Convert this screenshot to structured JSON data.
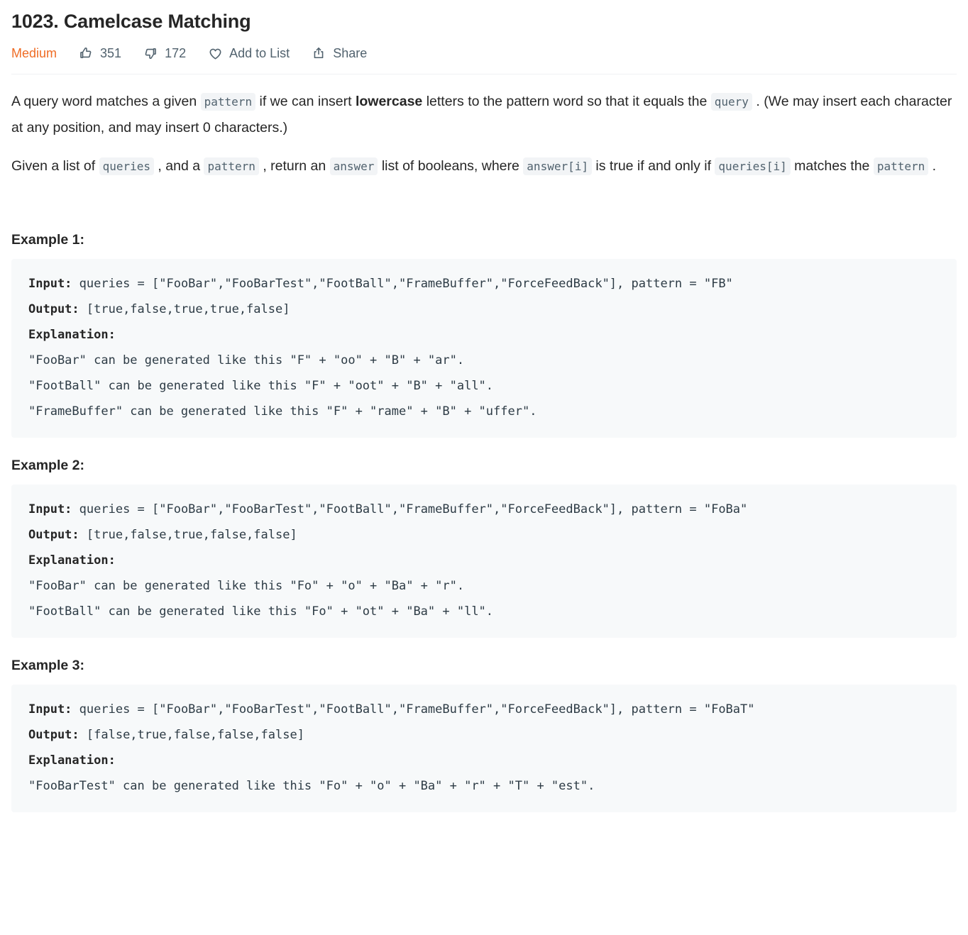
{
  "problem": {
    "title": "1023. Camelcase Matching",
    "difficulty": "Medium",
    "likes": "351",
    "dislikes": "172",
    "add_to_list_label": "Add to List",
    "share_label": "Share"
  },
  "icons": {
    "like": "thumbs-up-icon",
    "dislike": "thumbs-down-icon",
    "favorite": "heart-icon",
    "share": "share-icon"
  },
  "description": {
    "p1": {
      "t1": "A query word matches a given ",
      "c1": "pattern",
      "t2": " if we can insert ",
      "b1": "lowercase",
      "t3": " letters to the pattern word so that it equals the ",
      "c2": "query",
      "t4": " . (We may insert each character at any position, and may insert 0 characters.)"
    },
    "p2": {
      "t1": "Given a list of ",
      "c1": "queries",
      "t2": " , and a ",
      "c2": "pattern",
      "t3": " , return an ",
      "c3": "answer",
      "t4": " list of booleans, where ",
      "c4": "answer[i]",
      "t5": " is true if and only if ",
      "c5": "queries[i]",
      "t6": " matches the ",
      "c6": "pattern",
      "t7": " ."
    }
  },
  "examples": [
    {
      "heading": "Example 1:",
      "input_label": "Input:",
      "input_value": " queries = [\"FooBar\",\"FooBarTest\",\"FootBall\",\"FrameBuffer\",\"ForceFeedBack\"], pattern = \"FB\"",
      "output_label": "Output:",
      "output_value": " [true,false,true,true,false]",
      "explanation_label": "Explanation:",
      "explanation_lines": [
        "\"FooBar\" can be generated like this \"F\" + \"oo\" + \"B\" + \"ar\".",
        "\"FootBall\" can be generated like this \"F\" + \"oot\" + \"B\" + \"all\".",
        "\"FrameBuffer\" can be generated like this \"F\" + \"rame\" + \"B\" + \"uffer\"."
      ]
    },
    {
      "heading": "Example 2:",
      "input_label": "Input:",
      "input_value": " queries = [\"FooBar\",\"FooBarTest\",\"FootBall\",\"FrameBuffer\",\"ForceFeedBack\"], pattern = \"FoBa\"",
      "output_label": "Output:",
      "output_value": " [true,false,true,false,false]",
      "explanation_label": "Explanation:",
      "explanation_lines": [
        "\"FooBar\" can be generated like this \"Fo\" + \"o\" + \"Ba\" + \"r\".",
        "\"FootBall\" can be generated like this \"Fo\" + \"ot\" + \"Ba\" + \"ll\"."
      ]
    },
    {
      "heading": "Example 3:",
      "input_label": "Input:",
      "input_value": " queries = [\"FooBar\",\"FooBarTest\",\"FootBall\",\"FrameBuffer\",\"ForceFeedBack\"], pattern = \"FoBaT\"",
      "output_label": "Output:",
      "output_value": " [false,true,false,false,false]",
      "explanation_label": "Explanation:",
      "explanation_lines": [
        "\"FooBarTest\" can be generated like this \"Fo\" + \"o\" + \"Ba\" + \"r\" + \"T\" + \"est\"."
      ]
    }
  ],
  "colors": {
    "difficulty_medium": "#ef6c25",
    "meta_text": "#51626e",
    "code_block_bg": "#f7f9fa",
    "inline_code_bg": "#f2f4f6",
    "inline_code_text": "#51626e",
    "divider": "#eff1f3",
    "body_text": "#262626"
  }
}
